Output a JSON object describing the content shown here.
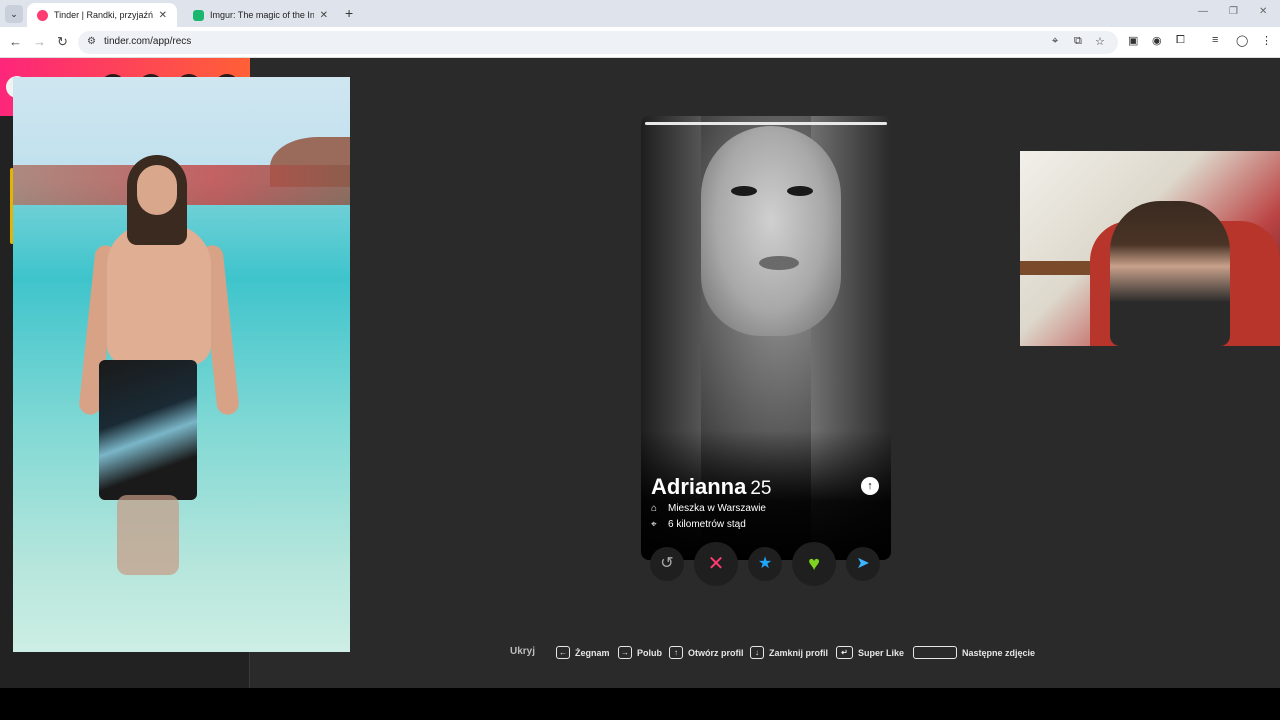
{
  "browser": {
    "tabs": [
      {
        "title": "Tinder | Randki, przyjaźń, nowe",
        "favicon_color": "#fe3c72",
        "active": true
      },
      {
        "title": "Imgur: The magic of the Interne",
        "favicon_color": "#1bb76e",
        "active": false
      }
    ],
    "url": "tinder.com/app/recs"
  },
  "card": {
    "name": "Adrianna",
    "age": "25",
    "lives": "Mieszka w Warszawie",
    "distance": "6 kilometrów stąd",
    "photo_progress": 1.0
  },
  "actions": {
    "rewind_icon": "↺",
    "nope_icon": "✕",
    "superlike_icon": "★",
    "like_icon": "♥",
    "boost_icon": "➤"
  },
  "shortcuts": {
    "hide": "Ukryj",
    "items": [
      {
        "key": "←",
        "label": "Żegnam"
      },
      {
        "key": "→",
        "label": "Polub"
      },
      {
        "key": "↑",
        "label": "Otwórz profil"
      },
      {
        "key": "↓",
        "label": "Zamknij profil"
      },
      {
        "key": "↵",
        "label": "Super Like"
      },
      {
        "key": "",
        "label": "Następne zdjęcie"
      }
    ]
  },
  "colors": {
    "brand_gradient_start": "#fd267a",
    "brand_gradient_end": "#ff6036",
    "nope": "#fe3c72",
    "superlike": "#1ea7ff",
    "like": "#7ed321",
    "boost": "#3cb4ff",
    "rewind": "#a8a8a8"
  }
}
